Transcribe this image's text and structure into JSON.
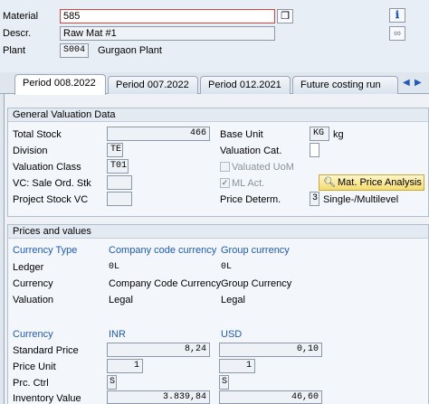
{
  "header": {
    "material_label": "Material",
    "material_value": "585",
    "descr_label": "Descr.",
    "descr_value": "Raw Mat #1",
    "plant_label": "Plant",
    "plant_value": "S004",
    "plant_name": "Gurgaon Plant"
  },
  "tabs": [
    {
      "label": "Period 008.2022",
      "active": true
    },
    {
      "label": "Period 007.2022",
      "active": false
    },
    {
      "label": "Period 012.2021",
      "active": false
    },
    {
      "label": "Future costing run",
      "active": false
    }
  ],
  "general": {
    "title": "General Valuation Data",
    "total_stock_label": "Total Stock",
    "total_stock_value": "466",
    "base_unit_label": "Base Unit",
    "base_unit_value": "KG",
    "base_unit_text": "kg",
    "division_label": "Division",
    "division_value": "TE",
    "valuation_cat_label": "Valuation Cat.",
    "valuation_class_label": "Valuation Class",
    "valuation_class_value": "T01",
    "valuated_uom_label": "Valuated UoM",
    "vc_sale_label": "VC: Sale Ord. Stk",
    "ml_act_label": "ML Act.",
    "ml_act_checked": "✓",
    "mat_price_button": "Mat. Price Analysis",
    "project_stock_label": "Project Stock VC",
    "price_determ_label": "Price Determ.",
    "price_determ_value": "3",
    "price_determ_text": "Single-/Multilevel"
  },
  "prices": {
    "title": "Prices and values",
    "currency_type_label": "Currency Type",
    "company_code_currency": "Company code currency",
    "group_currency": "Group currency",
    "ledger_label": "Ledger",
    "ledger_cc": "0L",
    "ledger_gc": "0L",
    "currency_label": "Currency",
    "currency_cc": "Company Code Currency",
    "currency_gc": "Group Currency",
    "valuation_label": "Valuation",
    "valuation_cc": "Legal",
    "valuation_gc": "Legal",
    "currency2_label": "Currency",
    "currency2_cc": "INR",
    "currency2_gc": "USD",
    "std_price_label": "Standard Price",
    "std_price_cc": "8,24",
    "std_price_gc": "0,10",
    "price_unit_label": "Price Unit",
    "price_unit_cc": "1",
    "price_unit_gc": "1",
    "prc_ctrl_label": "Prc. Ctrl",
    "prc_ctrl_cc": "S",
    "prc_ctrl_gc": "S",
    "inv_value_label": "Inventory Value",
    "inv_value_cc": "3.839,84",
    "inv_value_gc": "46,60"
  },
  "colors": {
    "accent_blue": "#1f5bb8",
    "button_yellow": "#f5dc6e"
  }
}
